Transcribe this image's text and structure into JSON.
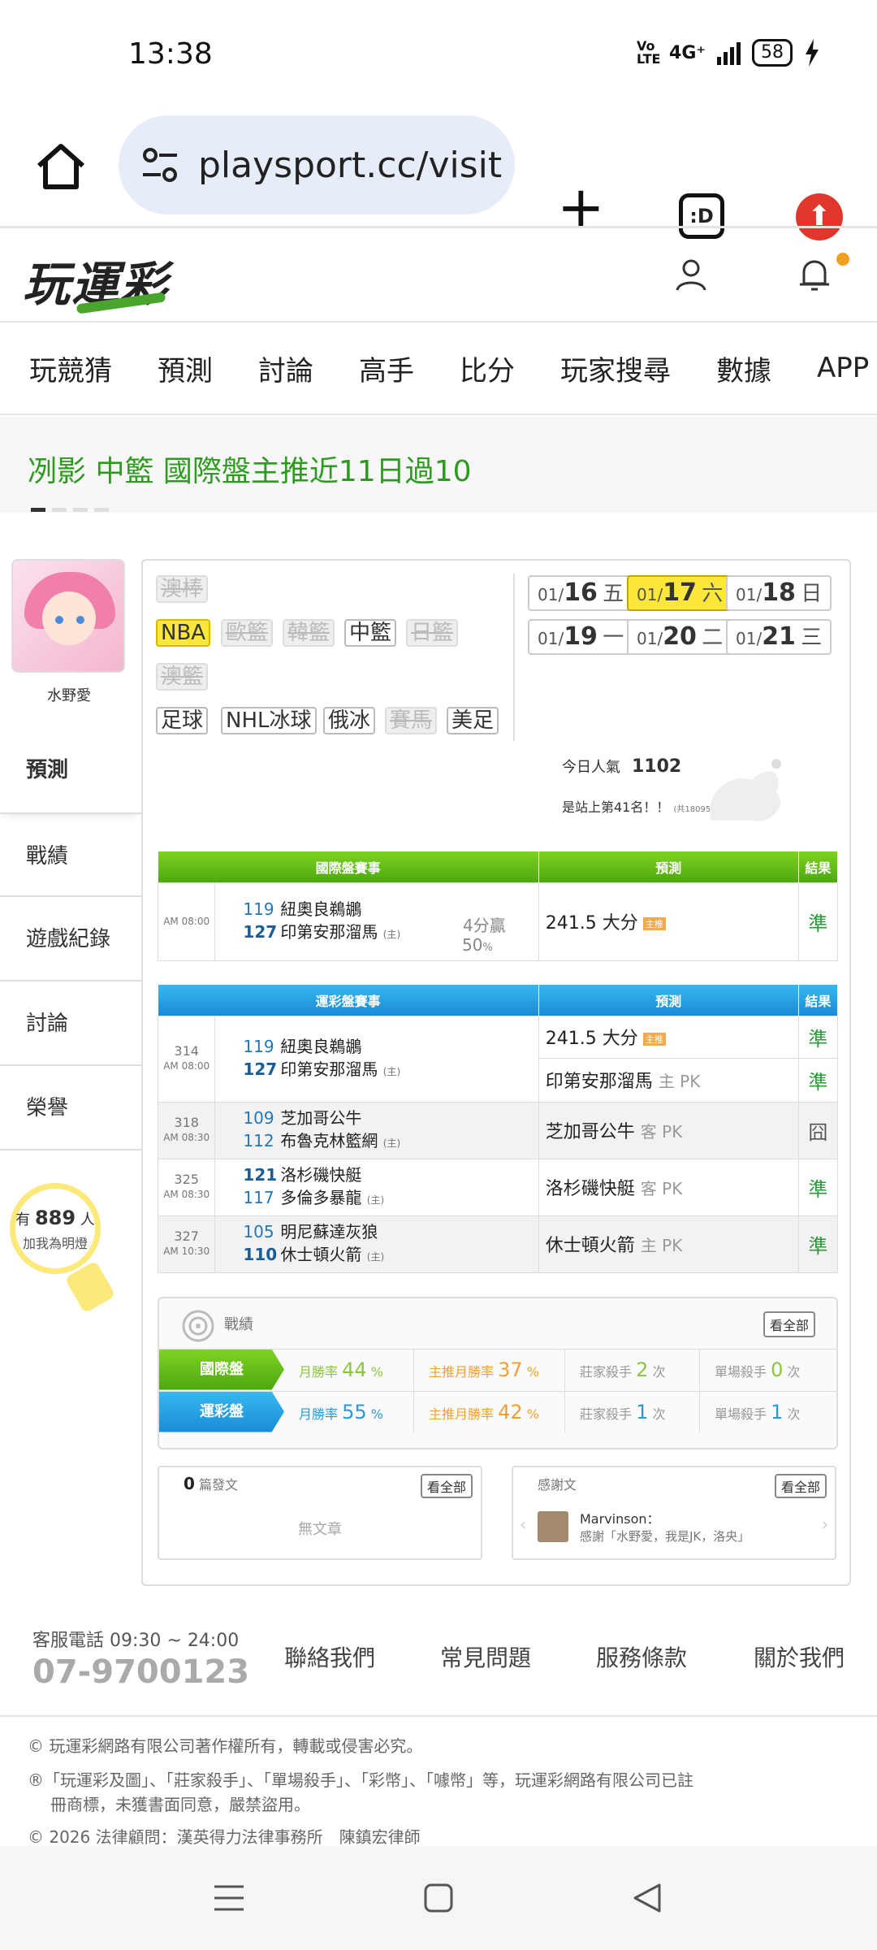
{
  "status_bar": {
    "time": "13:38",
    "network": "4G⁺",
    "volte": "Vo LTE",
    "battery": "58"
  },
  "browser": {
    "url": "playsport.cc/visit",
    "tabs_label": ":D"
  },
  "site": {
    "logo": "玩運彩"
  },
  "nav": [
    "玩競猜",
    "預測",
    "討論",
    "高手",
    "比分",
    "玩家搜尋",
    "數據",
    "APP"
  ],
  "banner": {
    "text": "冽影 中籃 國際盤主推近11日過10"
  },
  "profile": {
    "name": "水野愛",
    "fans_prefix": "有",
    "fans_count": "889",
    "fans_suffix": "人",
    "fans_cta": "加我為明燈"
  },
  "side_tabs": [
    "預測",
    "戰績",
    "遊戲紀錄",
    "討論",
    "榮譽"
  ],
  "sports": [
    "澳棒",
    "NBA",
    "歐籃",
    "韓籃",
    "中籃",
    "日籃",
    "澳籃",
    "足球",
    "NHL冰球",
    "俄冰",
    "賽馬",
    "美足"
  ],
  "dates": [
    {
      "md": "01/",
      "d": "16",
      "w": "五"
    },
    {
      "md": "01/",
      "d": "17",
      "w": "六"
    },
    {
      "md": "01/",
      "d": "18",
      "w": "日"
    },
    {
      "md": "01/",
      "d": "19",
      "w": "一"
    },
    {
      "md": "01/",
      "d": "20",
      "w": "二"
    },
    {
      "md": "01/",
      "d": "21",
      "w": "三"
    }
  ],
  "popularity": {
    "label": "今日人氣",
    "value": "1102",
    "rank_text": "是站上第41名！！",
    "rank_total": "(共18095人)"
  },
  "intl_table": {
    "headers": [
      "國際盤賽事",
      "預測",
      "結果"
    ],
    "row": {
      "time": "AM 08:00",
      "n1": "119",
      "t1": "紐奧良鵜鶘",
      "n2": "127",
      "t2": "印第安那溜馬",
      "home": "(主)",
      "spread": "4分贏",
      "pct": "50",
      "pct_unit": "%",
      "pred": "241.5 大分",
      "tag": "主推",
      "result": "準"
    }
  },
  "lottery_table": {
    "headers": [
      "運彩盤賽事",
      "預測",
      "結果"
    ],
    "rows": [
      {
        "id": "314",
        "time": "AM 08:00",
        "n1": "119",
        "t1": "紐奧良鵜鶘",
        "n2": "127",
        "t2": "印第安那溜馬",
        "home": "(主)",
        "pred1": "241.5 大分",
        "tag": "主推",
        "res1": "準",
        "pred2": "印第安那溜馬",
        "pred2b": "主 PK",
        "res2": "準"
      },
      {
        "id": "318",
        "time": "AM 08:30",
        "n1": "109",
        "t1": "芝加哥公牛",
        "n2": "112",
        "t2": "布魯克林籃網",
        "home": "(主)",
        "pred": "芝加哥公牛",
        "predb": "客 PK",
        "res": "囧"
      },
      {
        "id": "325",
        "time": "AM 08:30",
        "n1": "121",
        "t1": "洛杉磯快艇",
        "n2": "117",
        "t2": "多倫多暴龍",
        "home": "(主)",
        "pred": "洛杉磯快艇",
        "predb": "客 PK",
        "res": "準"
      },
      {
        "id": "327",
        "time": "AM 10:30",
        "n1": "105",
        "t1": "明尼蘇達灰狼",
        "n2": "110",
        "t2": "休士頓火箭",
        "home": "(主)",
        "pred": "休士頓火箭",
        "predb": "主 PK",
        "res": "準"
      }
    ]
  },
  "record": {
    "title": "戰績",
    "all": "看全部",
    "rows": [
      {
        "label": "國際盤",
        "m_label": "月勝率",
        "m_val": "44",
        "p_label": "主推月勝率",
        "p_val": "37",
        "unit": "%",
        "b_label": "莊家殺手",
        "b_val": "2",
        "s_label": "單場殺手",
        "s_val": "0",
        "times": "次"
      },
      {
        "label": "運彩盤",
        "m_label": "月勝率",
        "m_val": "55",
        "p_label": "主推月勝率",
        "p_val": "42",
        "unit": "%",
        "b_label": "莊家殺手",
        "b_val": "1",
        "s_label": "單場殺手",
        "s_val": "1",
        "times": "次"
      }
    ]
  },
  "posts": {
    "count": "0",
    "label": "篇發文",
    "all": "看全部",
    "empty": "無文章"
  },
  "thanks": {
    "title": "感謝文",
    "all": "看全部",
    "user": "Marvinson：",
    "text": "感謝「水野愛，我是JK，洛央」"
  },
  "footer": {
    "hours": "客服電話 09:30 ~ 24:00",
    "phone": "07-9700123",
    "links": [
      "聯絡我們",
      "常見問題",
      "服務條款",
      "關於我們"
    ],
    "copyright": "© 玩運彩網路有限公司著作權所有，轉載或侵害必究。",
    "trademark1": "®「玩運彩及圖」、「莊家殺手」、「單場殺手」、「彩幣」、「噱幣」等，玩運彩網路有限公司已註",
    "trademark2": "冊商標，未獲書面同意，嚴禁盜用。",
    "legal": "© 2026 法律顧問：漢英得力法律事務所　陳鎮宏律師"
  },
  "colors": {
    "green": "#2f9a20",
    "yellow": "#fde73a",
    "intl_header": "#6cc51b",
    "lottery_header": "#29a5e8",
    "orange": "#f0a030"
  }
}
